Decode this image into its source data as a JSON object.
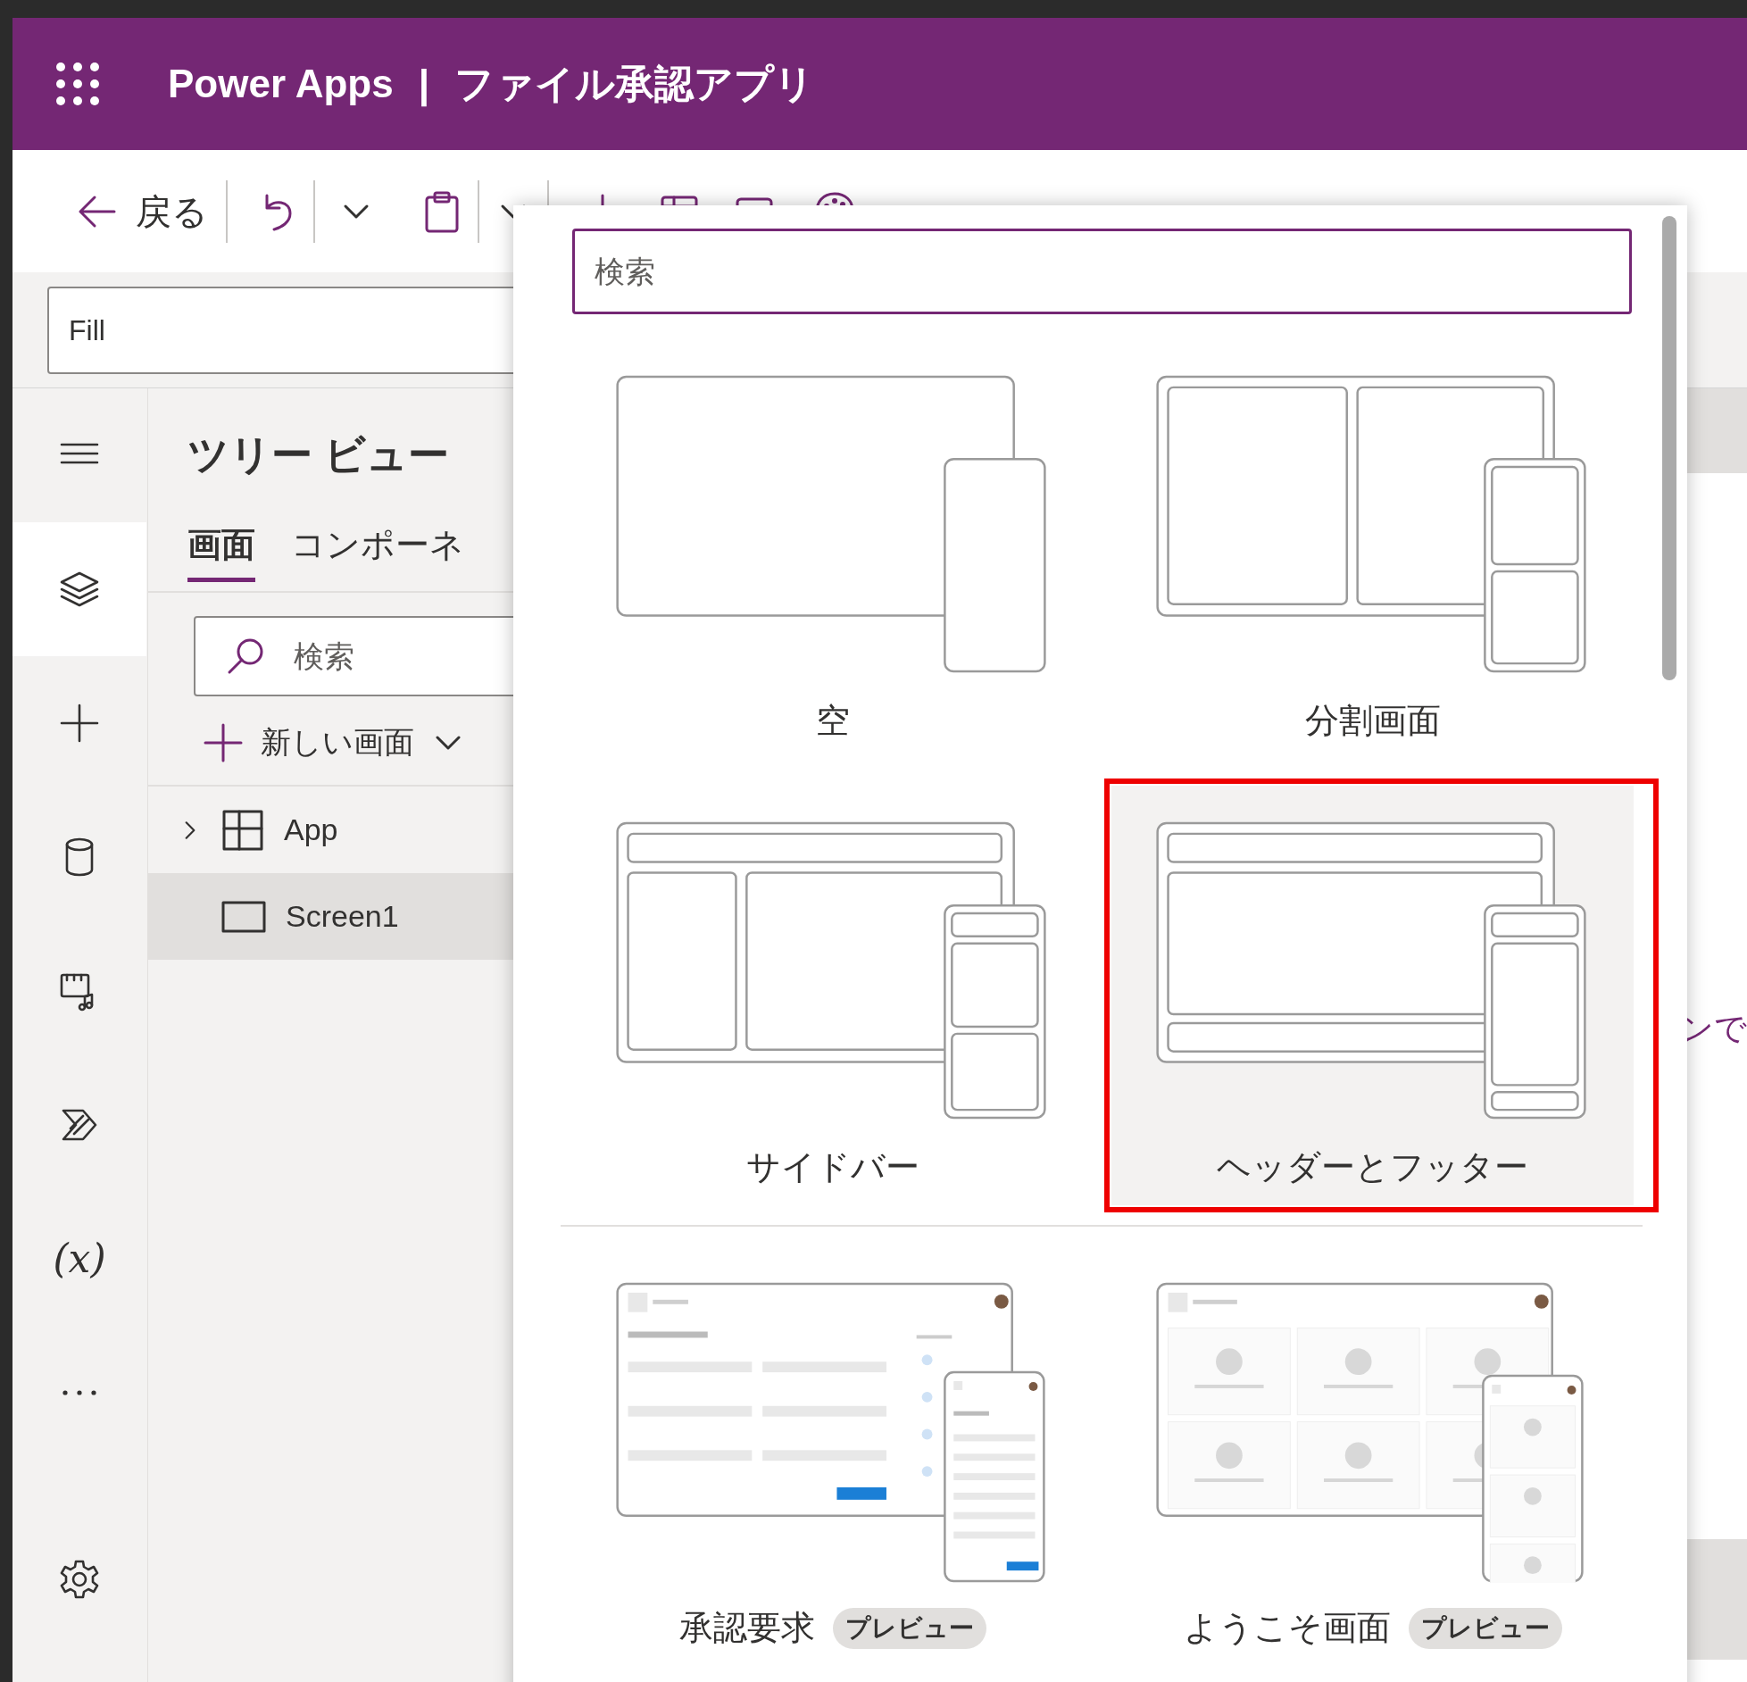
{
  "app_bar": {
    "product": "Power Apps",
    "separator": "|",
    "app_name": "ファイル承認アプリ"
  },
  "toolbar": {
    "back_label": "戻る",
    "items": [
      {
        "kind": "insert"
      },
      {
        "kind": "data"
      },
      {
        "kind": "screen"
      }
    ]
  },
  "formula_bar": {
    "property": "Fill"
  },
  "left_rail": {
    "items": [
      {
        "kind": "menu",
        "selected": false
      },
      {
        "kind": "layers",
        "selected": true
      },
      {
        "kind": "insert",
        "selected": false
      },
      {
        "kind": "data",
        "selected": false
      },
      {
        "kind": "media",
        "selected": false
      },
      {
        "kind": "automate",
        "selected": false
      },
      {
        "kind": "variables",
        "label": "(x)",
        "selected": false
      },
      {
        "kind": "more",
        "selected": false
      },
      {
        "kind": "settings",
        "selected": false
      }
    ]
  },
  "tree_view": {
    "title": "ツリー ビュー",
    "tabs": [
      {
        "label": "画面",
        "selected": true
      },
      {
        "label": "コンポーネ",
        "selected": false
      }
    ],
    "search": {
      "placeholder": "検索"
    },
    "new_screen": "新しい画面",
    "nodes": [
      {
        "kind": "app",
        "label": "App",
        "expanded": false,
        "selected": false
      },
      {
        "kind": "screen",
        "label": "Screen1",
        "selected": true
      }
    ]
  },
  "canvas": {
    "hint": "ンで"
  },
  "screen_picker": {
    "search": {
      "placeholder": "検索"
    },
    "layouts": [
      {
        "kind": "blank",
        "label": "空",
        "selected": false,
        "highlighted": false
      },
      {
        "kind": "split",
        "label": "分割画面",
        "selected": false,
        "highlighted": false
      },
      {
        "kind": "sidebar",
        "label": "サイドバー",
        "selected": false,
        "highlighted": false
      },
      {
        "kind": "header_footer",
        "label": "ヘッダーとフッター",
        "selected": true,
        "highlighted": true
      }
    ],
    "scenarios": [
      {
        "kind": "approval",
        "label": "承認要求",
        "badge": "プレビュー",
        "selected": false,
        "highlighted": false
      },
      {
        "kind": "welcome",
        "label": "ようこそ画面",
        "badge": "プレビュー",
        "selected": false,
        "highlighted": false
      }
    ]
  }
}
